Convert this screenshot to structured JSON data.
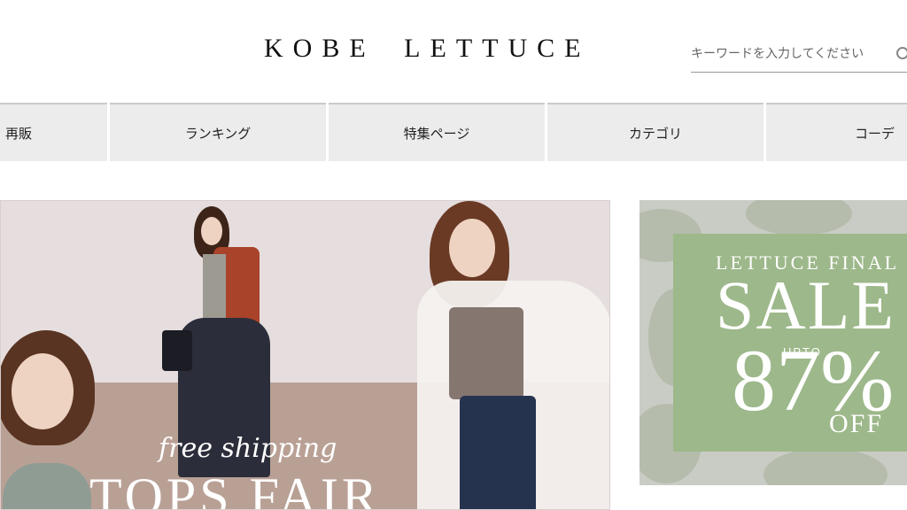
{
  "header": {
    "logo": "KOBE LETTUCE",
    "search_placeholder": "キーワードを入力してください"
  },
  "nav": {
    "items": [
      {
        "label": "再販"
      },
      {
        "label": "ランキング"
      },
      {
        "label": "特集ページ"
      },
      {
        "label": "カテゴリ"
      },
      {
        "label": "コーデ"
      }
    ]
  },
  "main_banner": {
    "script_text": "free shipping",
    "title": "TOPS FAIR"
  },
  "sale_banner": {
    "line1": "LETTUCE FINAL",
    "line2": "SALE",
    "upto": "UPTO",
    "percent": "87%",
    "off": "OFF"
  }
}
